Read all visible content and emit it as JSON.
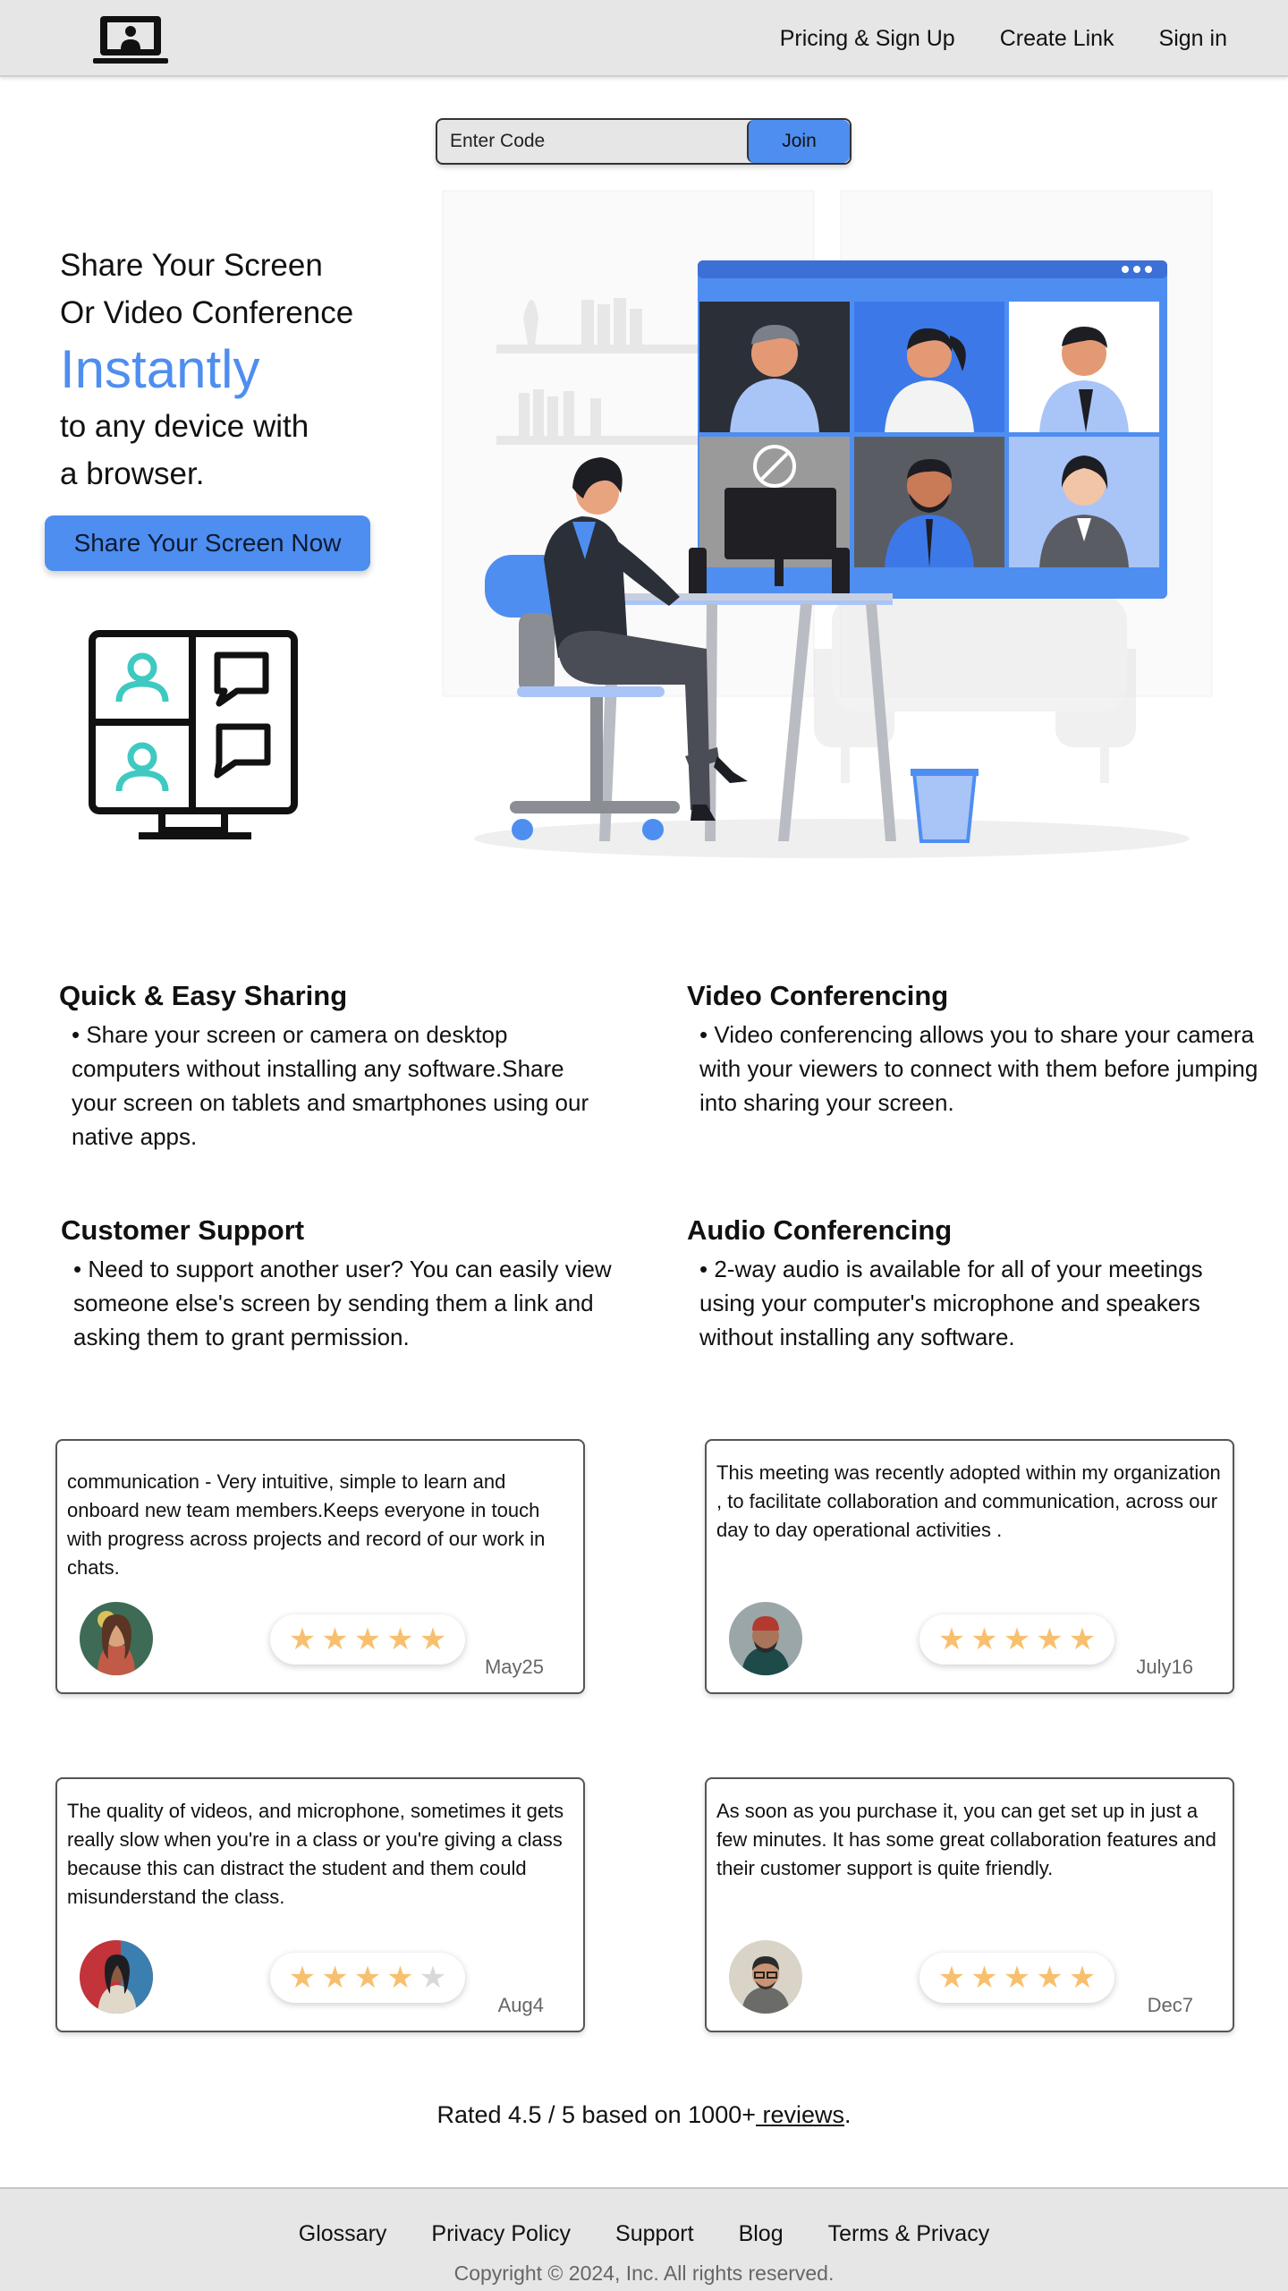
{
  "nav": {
    "links": [
      "Pricing & Sign Up",
      "Create Link",
      "Sign in"
    ]
  },
  "code_bar": {
    "placeholder": "Enter Code",
    "join_label": "Join"
  },
  "hero": {
    "line1": "Share Your Screen",
    "line2": "Or Video Conference",
    "accent": "Instantly",
    "line3": "to any device with",
    "line4": "a browser.",
    "cta_label": "Share Your Screen Now"
  },
  "features": [
    {
      "title": "Quick & Easy Sharing",
      "text": "• Share your screen or camera on desktop computers without installing any software.Share your screen on tablets and smartphones using our native apps."
    },
    {
      "title": "Video Conferencing",
      "text": "• Video conferencing allows you to share your camera with your viewers to connect with them before jumping into sharing your screen."
    },
    {
      "title": "Customer Support",
      "text": "• Need to support another user? You can easily view someone else's screen by sending them a link and asking them to grant permission."
    },
    {
      "title": "Audio Conferencing",
      "text": "• 2-way audio is available for all of your meetings using your computer's microphone and speakers without installing any software."
    }
  ],
  "reviews": [
    {
      "text": "communication - Very intuitive, simple to learn and onboard new team members.Keeps everyone in touch with progress across projects and record of our work in chats.",
      "date": "May25",
      "rating": 5
    },
    {
      "text": "This meeting was recently adopted within my organization , to facilitate collaboration and communication, across our day to day operational activities .",
      "date": "July16",
      "rating": 5
    },
    {
      "text": "The quality of videos, and microphone, sometimes it gets really slow when you're in a class or you're giving a class because this can distract the student and them could misunderstand the class.",
      "date": "Aug4",
      "rating": 4
    },
    {
      "text": "As soon as you purchase it, you can get set up in just a few minutes. It has some great collaboration features and their customer support is quite friendly.",
      "date": "Dec7",
      "rating": 5
    }
  ],
  "rating": {
    "prefix": "Rated 4.5 / 5 based on 1000+",
    "link": " reviews",
    "suffix": "."
  },
  "footer": {
    "links": [
      "Glossary",
      "Privacy Policy",
      "Support",
      "Blog",
      "Terms & Privacy"
    ],
    "copyright": "Copyright © 2024, Inc. All rights reserved."
  },
  "colors": {
    "accent": "#4e8ef0",
    "star_filled": "#f8c06e",
    "star_empty": "#d9d9d9",
    "nav_bg": "#e6e6e6",
    "teal_icon": "#3ec9c1"
  },
  "icons": {
    "logo": "laptop-user-icon",
    "monitor": "video-chat-monitor-icon"
  }
}
